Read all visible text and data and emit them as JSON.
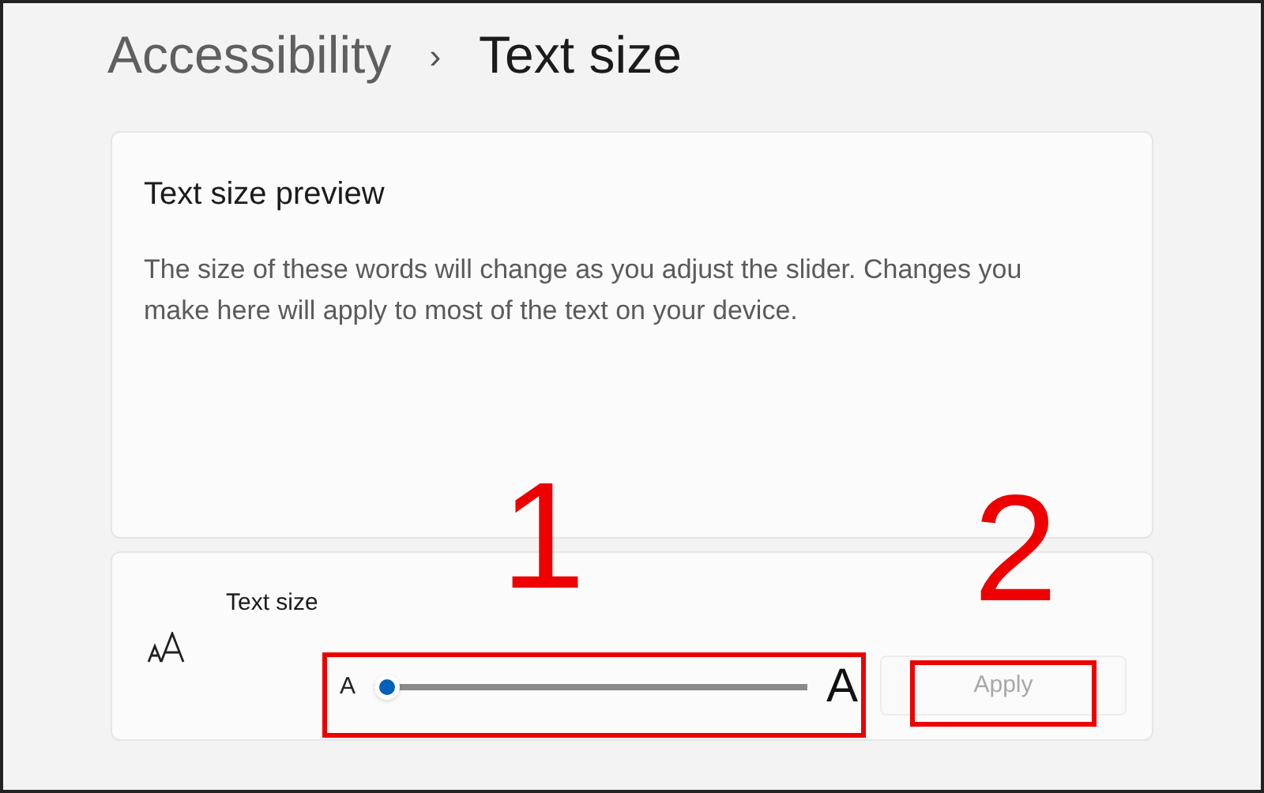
{
  "breadcrumb": {
    "parent": "Accessibility",
    "separator": "›",
    "current": "Text size"
  },
  "preview": {
    "title": "Text size preview",
    "body": "The size of these words will change as you adjust the slider. Changes you make here will apply to most of the text on your device."
  },
  "setting": {
    "label": "Text size",
    "slider": {
      "min_label": "A",
      "max_label": "A",
      "level": 0
    },
    "apply": {
      "label": "Apply",
      "disabled": true
    }
  },
  "annotations": [
    {
      "label": "1"
    },
    {
      "label": "2"
    }
  ]
}
